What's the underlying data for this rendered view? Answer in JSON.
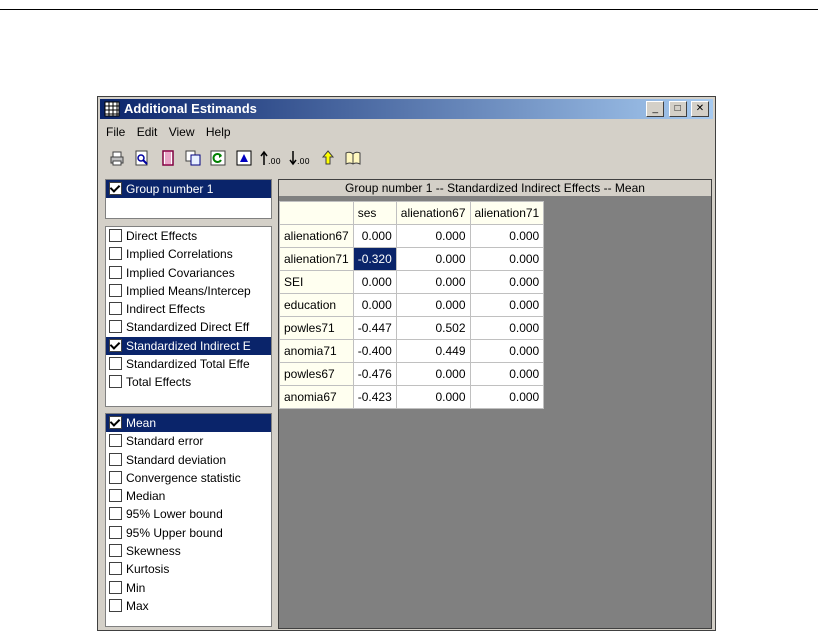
{
  "window": {
    "title": "Additional Estimands",
    "min_btn": "_",
    "max_btn": "□",
    "close_btn": "✕"
  },
  "menu": [
    "File",
    "Edit",
    "View",
    "Help"
  ],
  "toolbar_icons": [
    "print-icon",
    "preview-icon",
    "copy-rich-icon",
    "copy-icon",
    "refresh-icon",
    "export-icon",
    "increase-decimals-icon",
    "decrease-decimals-icon",
    "help-arrow-icon",
    "book-icon"
  ],
  "toolbar_text": {
    "inc": "↑.00",
    "dec": "↓.00"
  },
  "groups": [
    {
      "label": "Group number 1",
      "checked": true,
      "selected": true
    }
  ],
  "estimands": [
    {
      "label": "Direct Effects",
      "checked": false
    },
    {
      "label": "Implied Correlations",
      "checked": false
    },
    {
      "label": "Implied Covariances",
      "checked": false
    },
    {
      "label": "Implied Means/Intercep",
      "checked": false
    },
    {
      "label": "Indirect Effects",
      "checked": false
    },
    {
      "label": "Standardized Direct Eff",
      "checked": false
    },
    {
      "label": "Standardized Indirect E",
      "checked": true,
      "selected": true
    },
    {
      "label": "Standardized Total Effe",
      "checked": false
    },
    {
      "label": "Total Effects",
      "checked": false
    }
  ],
  "statistics": [
    {
      "label": "Mean",
      "checked": true,
      "selected": true
    },
    {
      "label": "Standard error",
      "checked": false
    },
    {
      "label": "Standard deviation",
      "checked": false
    },
    {
      "label": "Convergence statistic",
      "checked": false
    },
    {
      "label": "Median",
      "checked": false
    },
    {
      "label": "95% Lower bound",
      "checked": false
    },
    {
      "label": "95% Upper bound",
      "checked": false
    },
    {
      "label": "Skewness",
      "checked": false
    },
    {
      "label": "Kurtosis",
      "checked": false
    },
    {
      "label": "Min",
      "checked": false
    },
    {
      "label": "Max",
      "checked": false
    }
  ],
  "grid": {
    "title": "Group number 1 -- Standardized Indirect Effects -- Mean",
    "columns": [
      "ses",
      "alienation67",
      "alienation71"
    ],
    "rows": [
      {
        "label": "alienation67",
        "values": [
          "0.000",
          "0.000",
          "0.000"
        ]
      },
      {
        "label": "alienation71",
        "values": [
          "-0.320",
          "0.000",
          "0.000"
        ]
      },
      {
        "label": "SEI",
        "values": [
          "0.000",
          "0.000",
          "0.000"
        ]
      },
      {
        "label": "education",
        "values": [
          "0.000",
          "0.000",
          "0.000"
        ]
      },
      {
        "label": "powles71",
        "values": [
          "-0.447",
          "0.502",
          "0.000"
        ]
      },
      {
        "label": "anomia71",
        "values": [
          "-0.400",
          "0.449",
          "0.000"
        ]
      },
      {
        "label": "powles67",
        "values": [
          "-0.476",
          "0.000",
          "0.000"
        ]
      },
      {
        "label": "anomia67",
        "values": [
          "-0.423",
          "0.000",
          "0.000"
        ]
      }
    ],
    "selected_cell": {
      "row": 1,
      "col": 0
    }
  },
  "colors": {
    "title_start": "#0a246a",
    "title_end": "#a6caf0",
    "selection": "#0a246a",
    "face": "#d4d0c8",
    "header_bg": "#fffff0"
  }
}
